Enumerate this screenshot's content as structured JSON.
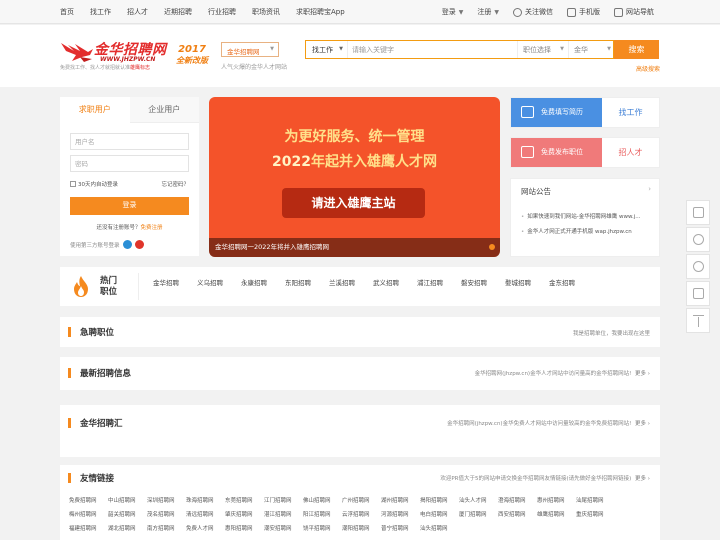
{
  "topbar": {
    "nav": [
      "首页",
      "找工作",
      "招人才",
      "近期招聘",
      "行业招聘",
      "职场资讯",
      "求职招聘宝App"
    ],
    "login": "登录",
    "register": "注册",
    "wechat": "关注微信",
    "mobile": "手机版",
    "sitenav": "网站导航"
  },
  "header": {
    "logo_name": "金华招聘网",
    "logo_url": "WWW.JHZPW.CN",
    "logo_tag_prefix": "免费找工作、找人才就招就认准",
    "logo_tag_brand": "雄鹰标志",
    "badge_year": "2017",
    "badge_edition": "全新改版",
    "site_select": "金华招聘网",
    "site_sub": "人气火爆的金华人才网站"
  },
  "search": {
    "type": "找工作",
    "placeholder": "请输入关键字",
    "position": "职位选择",
    "area": "金华",
    "button": "搜索",
    "advanced": "高级搜索"
  },
  "login": {
    "tab_seeker": "求职用户",
    "tab_company": "企业用户",
    "user_placeholder": "用户名",
    "pass_placeholder": "密码",
    "auto_login": "30天内自动登录",
    "forgot": "忘记密码？",
    "submit": "登录",
    "no_account": "还没有注册账号？",
    "register_now": "免费注册",
    "third_party": "使用第三方账号登录"
  },
  "banner": {
    "line1": "为更好服务、统一管理",
    "line2_pre": "2022",
    "line2_post": "年起并入雄鹰人才网",
    "cta": "请进入雄鹰主站",
    "caption": "金华招聘网一2022年将并入雄鹰招聘网"
  },
  "quick": {
    "resume_label": "免费填写简历",
    "resume_action": "找工作",
    "job_label": "免费发布职位",
    "job_action": "招人才"
  },
  "notice": {
    "title": "网站公告",
    "more": "›",
    "items": [
      "如果快速到我们网站-金华招聘网雄鹰 www.j...",
      "金华人才网正式开通手机版 wap.jhzpw.cn"
    ]
  },
  "hot": {
    "title_l1": "热门",
    "title_l2": "职位",
    "items": [
      "金华招聘",
      "义乌招聘",
      "永康招聘",
      "东阳招聘",
      "兰溪招聘",
      "武义招聘",
      "浦江招聘",
      "磐安招聘",
      "婺城招聘",
      "金东招聘"
    ]
  },
  "sections": {
    "urgent_title": "急聘职位",
    "urgent_note": "我是招聘单位，我要出现在这里",
    "latest_title": "最新招聘信息",
    "latest_note": "金华招聘网(jhzpw.cn)金华人才网站中访问量高的金华招聘网站!",
    "latest_more": "更多 ›",
    "hui_title": "金华招聘汇",
    "hui_note": "金华招聘网(jhzpw.cn)金华免费人才网站中访问量较高的金华免费招聘网站!",
    "hui_more": "更多 ›",
    "links_title": "友情链接",
    "links_note": "欢迎PR值大于5的网站申请交换金华招聘网友情链接(请先做好金华招聘网链接)",
    "links_more": "更多 ›"
  },
  "friend_links": [
    [
      "免费招聘网",
      "中山招聘网",
      "深圳招聘网",
      "珠海招聘网",
      "东莞招聘网",
      "江门招聘网",
      "佛山招聘网",
      "广州招聘网",
      "湖州招聘网",
      "揭阳招聘网",
      "汕头人才网",
      "澄海招聘网",
      "惠州招聘网",
      "汕尾招聘网"
    ],
    [
      "梅州招聘网",
      "韶关招聘网",
      "茂名招聘网",
      "清远招聘网",
      "肇庆招聘网",
      "湛江招聘网",
      "阳江招聘网",
      "云浮招聘网",
      "河源招聘网",
      "电白招聘网",
      "厦门招聘网",
      "西安招聘网",
      "雄鹰招聘网",
      "重庆招聘网"
    ],
    [
      "福建招聘网",
      "湖北招聘网",
      "南方招聘网",
      "免费人才网",
      "惠阳招聘网",
      "潮安招聘网",
      "饶平招聘网",
      "潮阳招聘网",
      "普宁招聘网",
      "汕头招聘网"
    ]
  ],
  "colors": {
    "accent": "#f58a1f",
    "banner": "#f4532a",
    "resume_blue": "#4a90e2",
    "job_red": "#f07a7a"
  }
}
